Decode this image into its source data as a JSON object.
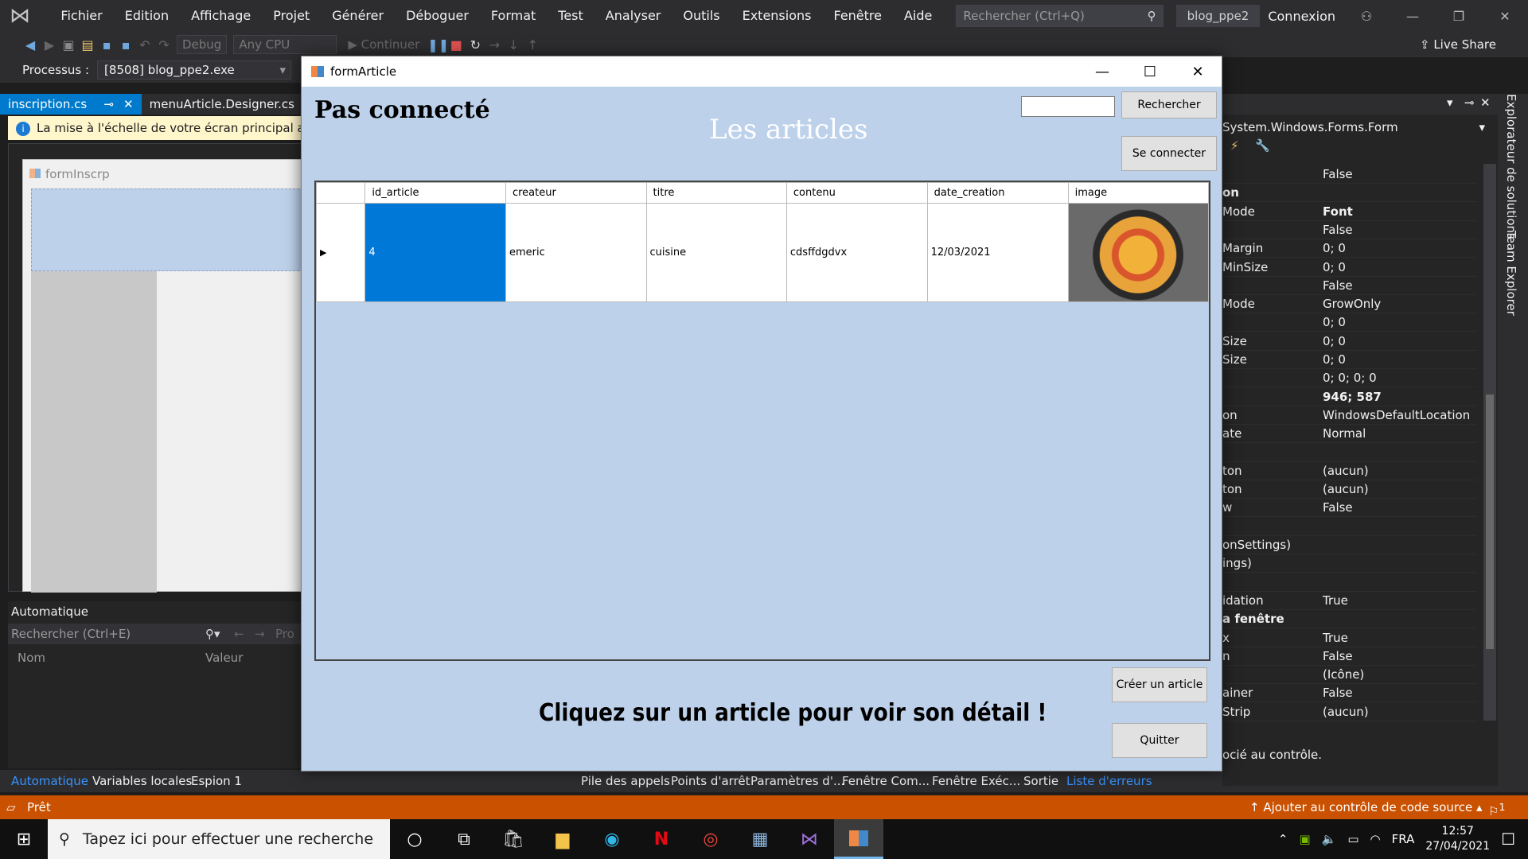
{
  "vs": {
    "menu": [
      "Fichier",
      "Edition",
      "Affichage",
      "Projet",
      "Générer",
      "Déboguer",
      "Format",
      "Test",
      "Analyser",
      "Outils",
      "Extensions",
      "Fenêtre",
      "Aide"
    ],
    "search_placeholder": "Rechercher (Ctrl+Q)",
    "project_name": "blog_ppe2",
    "login": "Connexion",
    "toolbar": {
      "config": "Debug",
      "platform": "Any CPU",
      "continue": "Continuer",
      "live_share": "Live Share"
    },
    "process_label": "Processus :",
    "process_value": "[8508] blog_ppe2.exe",
    "tabs": {
      "active": "inscription.cs [Design]",
      "second": "menuArticle.Designer.cs"
    },
    "info_message": "La mise à l'échelle de votre écran principal a la val",
    "designer_form_title": "formInscrp",
    "auto_panel": {
      "title": "Automatique",
      "search": "Rechercher (Ctrl+E)",
      "prof": "Pro",
      "col_name": "Nom",
      "col_value": "Valeur"
    },
    "bottom_tabs": [
      "Automatique",
      "Variables locales",
      "Espion 1",
      "Pile des appels",
      "Points d'arrêt",
      "Paramètres d'...",
      "Fenêtre Com...",
      "Fenêtre Exéc...",
      "Sortie",
      "Liste d'erreurs"
    ],
    "status_ready": "Prêt",
    "source_control": "Ajouter au contrôle de code source",
    "notif_count": "1",
    "props_header": "System.Windows.Forms.Form",
    "properties": [
      {
        "name": "",
        "value": "False",
        "bold": false
      },
      {
        "name": "on",
        "value": "",
        "bold": true
      },
      {
        "name": "Mode",
        "value": "Font",
        "bold": false,
        "vbold": true
      },
      {
        "name": "",
        "value": "False",
        "bold": false
      },
      {
        "name": "Margin",
        "value": "0; 0",
        "bold": false
      },
      {
        "name": "MinSize",
        "value": "0; 0",
        "bold": false
      },
      {
        "name": "",
        "value": "False",
        "bold": false
      },
      {
        "name": "Mode",
        "value": "GrowOnly",
        "bold": false
      },
      {
        "name": "",
        "value": "0; 0",
        "bold": false
      },
      {
        "name": "Size",
        "value": "0; 0",
        "bold": false
      },
      {
        "name": "Size",
        "value": "0; 0",
        "bold": false
      },
      {
        "name": "",
        "value": "0; 0; 0; 0",
        "bold": false
      },
      {
        "name": "",
        "value": "946; 587",
        "bold": false,
        "vbold": true
      },
      {
        "name": "on",
        "value": "WindowsDefaultLocation",
        "bold": false
      },
      {
        "name": "ate",
        "value": "Normal",
        "bold": false
      },
      {
        "name": "",
        "value": "",
        "bold": false
      },
      {
        "name": "ton",
        "value": "(aucun)",
        "bold": false
      },
      {
        "name": "ton",
        "value": "(aucun)",
        "bold": false
      },
      {
        "name": "w",
        "value": "False",
        "bold": false
      },
      {
        "name": "",
        "value": "",
        "bold": false
      },
      {
        "name": "onSettings)",
        "value": "",
        "bold": false
      },
      {
        "name": "ings)",
        "value": "",
        "bold": false
      },
      {
        "name": "",
        "value": "",
        "bold": false
      },
      {
        "name": "idation",
        "value": "True",
        "bold": false
      },
      {
        "name": "a fenêtre",
        "value": "",
        "bold": true
      },
      {
        "name": "x",
        "value": "True",
        "bold": false
      },
      {
        "name": "n",
        "value": "False",
        "bold": false
      },
      {
        "name": "",
        "value": "(Icône)",
        "bold": false
      },
      {
        "name": "ainer",
        "value": "False",
        "bold": false
      },
      {
        "name": "Strip",
        "value": "(aucun)",
        "bold": false
      }
    ],
    "props_footer": "ocié au contrôle.",
    "side_vertical": [
      "Explorateur de solutions",
      "Team Explorer"
    ]
  },
  "form": {
    "title": "formArticle",
    "status": "Pas connecté",
    "heading": "Les articles",
    "search_value": "",
    "search_button": "Rechercher",
    "login_button": "Se connecter",
    "create_button": "Créer un article",
    "quit_button": "Quitter",
    "hint": "Cliquez sur un article pour voir son détail !",
    "grid": {
      "columns": [
        "id_article",
        "createur",
        "titre",
        "contenu",
        "date_creation",
        "image"
      ],
      "rows": [
        {
          "id_article": "4",
          "createur": "emeric",
          "titre": "cuisine",
          "contenu": "cdsffdgdvx",
          "date_creation": "12/03/2021",
          "image": "paella-photo"
        }
      ]
    }
  },
  "taskbar": {
    "search_placeholder": "Tapez ici pour effectuer une recherche",
    "language": "FRA",
    "time": "12:57",
    "date": "27/04/2021"
  }
}
